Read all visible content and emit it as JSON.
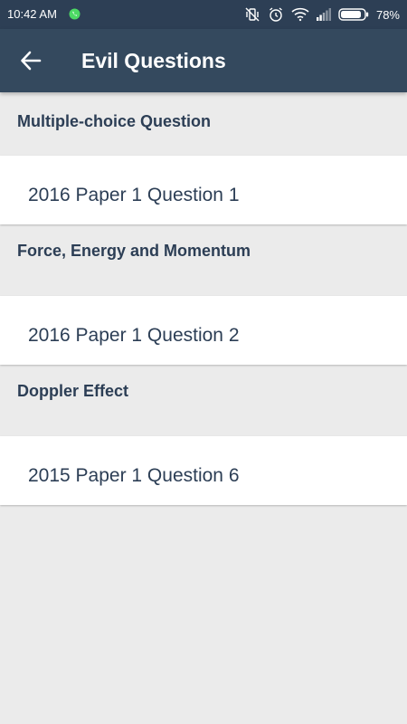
{
  "status_bar": {
    "time": "10:42 AM",
    "battery": "78%",
    "icons": [
      "whatsapp-icon",
      "vibrate-off-icon",
      "alarm-icon",
      "wifi-icon",
      "signal-icon",
      "battery-icon"
    ]
  },
  "app_bar": {
    "title": "Evil Questions",
    "back_icon": "arrow-left-icon"
  },
  "colors": {
    "primary": "#34495e",
    "status_bar": "#2d3f55",
    "background": "#ebebeb",
    "text": "#2c3e55"
  },
  "sections": [
    {
      "header": "Multiple-choice Question",
      "items": [
        "2016 Paper 1 Question 1"
      ]
    },
    {
      "header": "Force, Energy and Momentum",
      "items": [
        "2016 Paper 1 Question 2"
      ]
    },
    {
      "header": "Doppler Effect",
      "items": [
        "2015 Paper 1 Question 6"
      ]
    }
  ]
}
